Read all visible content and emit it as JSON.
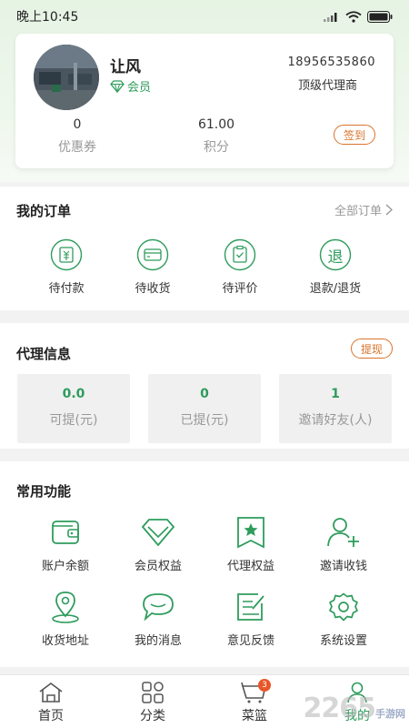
{
  "status_bar": {
    "time": "晚上10:45"
  },
  "profile": {
    "name": "让风",
    "member_label": "会员",
    "phone": "18956535860",
    "level": "顶级代理商",
    "coupons": {
      "value": "0",
      "label": "优惠券"
    },
    "points": {
      "value": "61.00",
      "label": "积分"
    },
    "signin_label": "签到"
  },
  "orders": {
    "title": "我的订单",
    "all_label": "全部订单",
    "items": [
      {
        "label": "待付款",
        "icon": "payment-icon"
      },
      {
        "label": "待收货",
        "icon": "wallet-card-icon"
      },
      {
        "label": "待评价",
        "icon": "clipboard-check-icon"
      },
      {
        "label": "退款/退货",
        "icon": "refund-icon"
      }
    ],
    "refund_glyph": "退"
  },
  "agent": {
    "title": "代理信息",
    "withdraw_label": "提现",
    "boxes": [
      {
        "value": "0.0",
        "label": "可提(元)"
      },
      {
        "value": "0",
        "label": "已提(元)"
      },
      {
        "value": "1",
        "label": "邀请好友(人)"
      }
    ]
  },
  "functions": {
    "title": "常用功能",
    "items": [
      {
        "label": "账户余额",
        "icon": "wallet-icon"
      },
      {
        "label": "会员权益",
        "icon": "diamond-icon"
      },
      {
        "label": "代理权益",
        "icon": "star-badge-icon"
      },
      {
        "label": "邀请收钱",
        "icon": "add-user-icon"
      },
      {
        "label": "收货地址",
        "icon": "location-pin-icon"
      },
      {
        "label": "我的消息",
        "icon": "chat-bubble-icon"
      },
      {
        "label": "意见反馈",
        "icon": "feedback-edit-icon"
      },
      {
        "label": "系统设置",
        "icon": "gear-icon"
      }
    ]
  },
  "tabbar": {
    "tabs": [
      {
        "label": "首页",
        "icon": "home-icon"
      },
      {
        "label": "分类",
        "icon": "category-icon"
      },
      {
        "label": "菜篮",
        "icon": "basket-icon",
        "badge": "3"
      },
      {
        "label": "我的",
        "icon": "profile-icon"
      }
    ]
  },
  "watermark": {
    "text": "2265",
    "sub": "手游网"
  },
  "colors": {
    "accent": "#2e9c5c",
    "orange": "#d9732b",
    "badge": "#e8562a"
  }
}
